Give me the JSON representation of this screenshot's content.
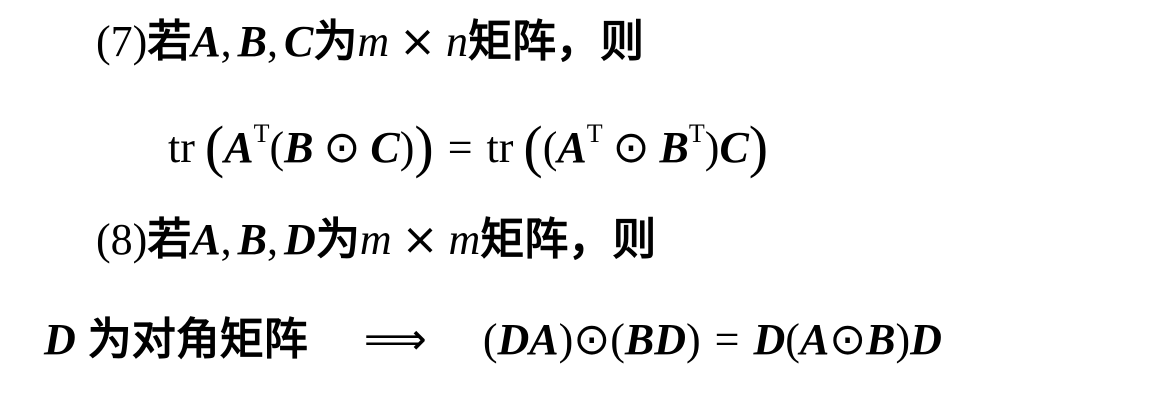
{
  "item7": {
    "label": "(7)",
    "if_word": "若",
    "mats": [
      "A",
      "B",
      "C"
    ],
    "comma": ",",
    "is_word": "为",
    "dim_row": "m",
    "times": "×",
    "dim_col": "n",
    "matrix_word": "矩阵",
    "then_word": "，则"
  },
  "eq7": {
    "tr": "tr",
    "A": "A",
    "B": "B",
    "C": "C",
    "T": "T",
    "odot": "⊙",
    "equals": "=",
    "lparen": "(",
    "rparen": ")"
  },
  "item8": {
    "label": "(8)",
    "if_word": "若",
    "mats": [
      "A",
      "B",
      "D"
    ],
    "comma": ",",
    "is_word": "为",
    "dim_row": "m",
    "times": "×",
    "dim_col": "m",
    "matrix_word": "矩阵",
    "then_word": "，则"
  },
  "eq8": {
    "D": "D",
    "condition": "为对角矩阵",
    "implies": "⟹",
    "A": "A",
    "B": "B",
    "odot": "⊙",
    "equals": "=",
    "lparen": "(",
    "rparen": ")"
  }
}
